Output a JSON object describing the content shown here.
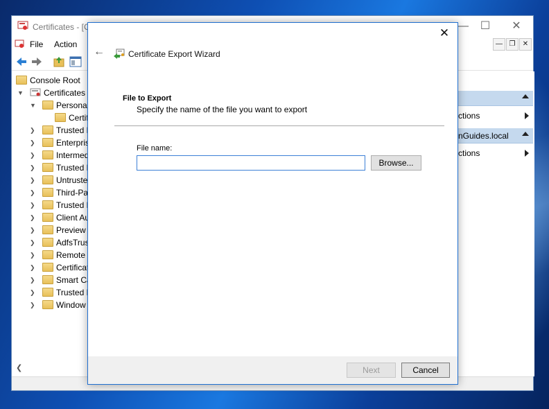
{
  "mmc": {
    "title": "Certificates - [C",
    "menu": {
      "file": "File",
      "action": "Action"
    },
    "window_buttons": {
      "minimize": "—",
      "maximize": "☐",
      "close": "✕"
    },
    "mdi_buttons": {
      "minimize": "—",
      "restore": "❐",
      "close": "✕"
    },
    "tree": {
      "console_root": "Console Root",
      "certificates": "Certificates (",
      "personal": "Personal",
      "certificates_child": "Certific",
      "folders": [
        "Trusted R",
        "Enterpris",
        "Intermed",
        "Trusted P",
        "Untruste",
        "Third-Pa",
        "Trusted P",
        "Client Au",
        "Preview",
        "AdfsTrus",
        "Remote",
        "Certificat",
        "Smart Ca",
        "Trusted D",
        "Window"
      ]
    },
    "actions": {
      "section1_items": "ctions",
      "section2_header": "nGuides.local",
      "section2_items": "ctions"
    }
  },
  "wizard": {
    "title": "Certificate Export Wizard",
    "close_glyph": "✕",
    "back_glyph": "←",
    "section_title": "File to Export",
    "section_desc": "Specify the name of the file you want to export",
    "file_name_label": "File name:",
    "file_name_value": "",
    "browse_label": "Browse...",
    "next_label": "Next",
    "cancel_label": "Cancel"
  },
  "colors": {
    "accent_border": "#1f6fd0",
    "actions_header": "#c5d9ee",
    "footer_bg": "#f0f0f0"
  }
}
